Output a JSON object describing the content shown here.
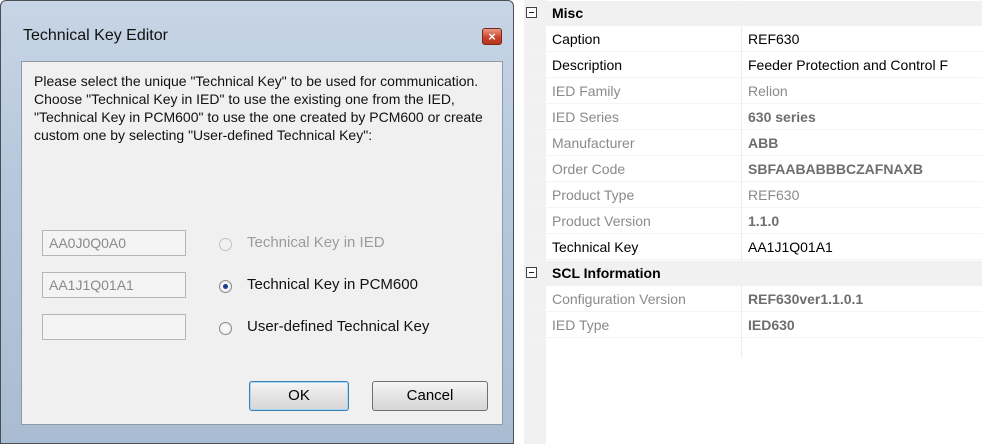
{
  "dialog": {
    "title": "Technical Key Editor",
    "close_glyph": "×",
    "instructions": "Please select the unique \"Technical Key\" to be used for communication.  Choose \"Technical Key in IED\" to use the existing one from the IED, \"Technical Key in PCM600\" to use the one created by PCM600 or create custom one by selecting  \"User-defined Technical Key\":",
    "options": [
      {
        "value": "AA0J0Q0A0",
        "label": "Technical Key in IED",
        "checked": false,
        "enabled": false
      },
      {
        "value": "AA1J1Q01A1",
        "label": "Technical Key in PCM600",
        "checked": true,
        "enabled": true
      },
      {
        "value": "",
        "label": "User-defined Technical Key",
        "checked": false,
        "enabled": true
      }
    ],
    "ok_label": "OK",
    "cancel_label": "Cancel"
  },
  "property_grid": {
    "categories": [
      {
        "name": "Misc",
        "rows": [
          {
            "name": "Caption",
            "value": "REF630",
            "readonly": false,
            "bold": false
          },
          {
            "name": "Description",
            "value": "Feeder Protection and Control F",
            "readonly": false,
            "bold": false
          },
          {
            "name": "IED Family",
            "value": "Relion",
            "readonly": true,
            "bold": false
          },
          {
            "name": "IED Series",
            "value": "630 series",
            "readonly": true,
            "bold": true
          },
          {
            "name": "Manufacturer",
            "value": "ABB",
            "readonly": true,
            "bold": true
          },
          {
            "name": "Order Code",
            "value": "SBFAABABBBCZAFNAXB",
            "readonly": true,
            "bold": true
          },
          {
            "name": "Product Type",
            "value": "REF630",
            "readonly": true,
            "bold": false
          },
          {
            "name": "Product Version",
            "value": "1.1.0",
            "readonly": true,
            "bold": true
          },
          {
            "name": "Technical Key",
            "value": "AA1J1Q01A1",
            "readonly": false,
            "bold": false
          }
        ]
      },
      {
        "name": "SCL Information",
        "rows": [
          {
            "name": "Configuration Version",
            "value": "REF630ver1.1.0.1",
            "readonly": true,
            "bold": true
          },
          {
            "name": "IED Type",
            "value": "IED630",
            "readonly": true,
            "bold": true
          }
        ]
      }
    ]
  }
}
